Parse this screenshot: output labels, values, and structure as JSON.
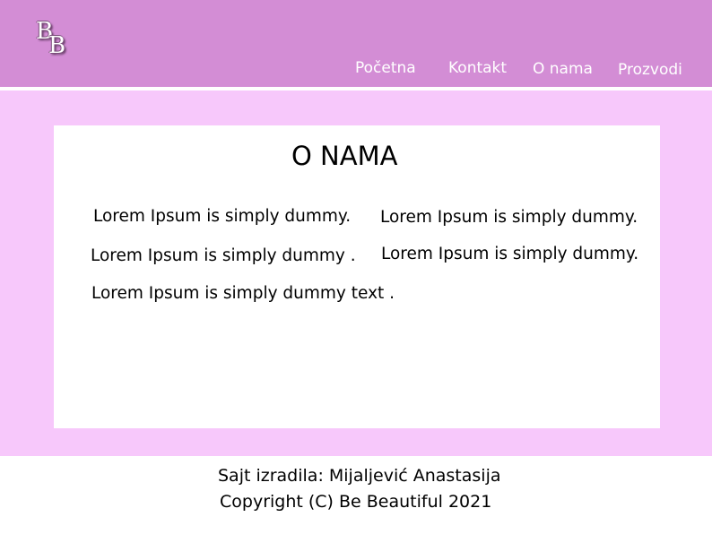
{
  "logo": {
    "letter1": "B",
    "letter2": "B"
  },
  "nav": [
    {
      "label": "Početna"
    },
    {
      "label": "Kontakt"
    },
    {
      "label": "O nama"
    },
    {
      "label": "Prozvodi"
    }
  ],
  "main": {
    "title": "O NAMA",
    "lines": [
      "Lorem Ipsum is simply dummy.",
      "Lorem Ipsum is simply dummy.",
      "Lorem Ipsum is simply dummy .",
      "Lorem Ipsum is simply dummy.",
      "Lorem Ipsum is simply dummy text ."
    ]
  },
  "footer": {
    "author": "Sajt izradila: Mijaljević Anastasija",
    "copyright": "Copyright (C) Be Beautiful 2021"
  },
  "colors": {
    "header": "#d38dd5",
    "band": "#f7c8fb",
    "card": "#ffffff"
  }
}
